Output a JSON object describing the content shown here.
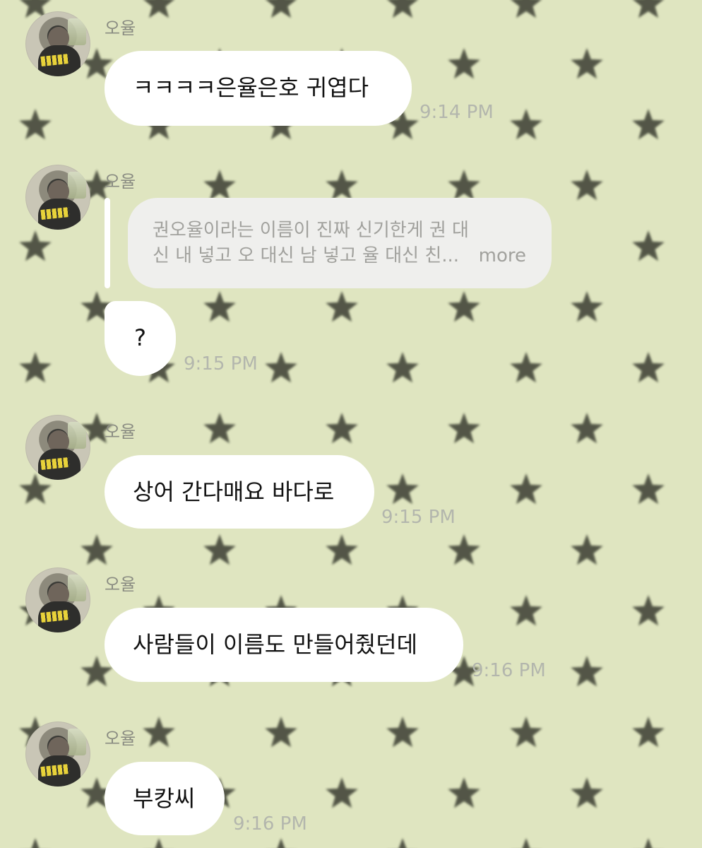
{
  "chat": {
    "background_color": "#dfe5c0",
    "pattern_icon": "star-icon",
    "pattern_color": "#3b3d30",
    "bubble_color": "#ffffff",
    "quote_color": "#efefed",
    "messages": [
      {
        "sender": "오율",
        "text": "ㅋㅋㅋㅋ은율은호 귀엽다",
        "time": "9:14 PM"
      },
      {
        "sender": "오율",
        "reply": {
          "line1": "권오율이라는 이름이 진짜 신기한게 권 대",
          "line2": "신 내 넣고 오 대신 남 넣고 율 대신 친...",
          "more": "more"
        },
        "text": "?",
        "time": "9:15 PM"
      },
      {
        "sender": "오율",
        "text": "상어 간다매요 바다로",
        "time": "9:15 PM"
      },
      {
        "sender": "오율",
        "text": "사람들이 이름도 만들어줬던데",
        "time": "9:16 PM"
      },
      {
        "sender": "오율",
        "text": "부캉씨",
        "time": "9:16 PM"
      }
    ]
  }
}
